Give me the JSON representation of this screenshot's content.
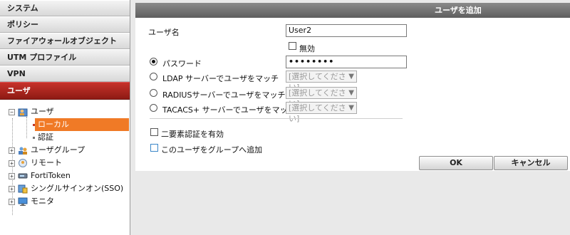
{
  "sidebar": {
    "nav": [
      {
        "label": "システム"
      },
      {
        "label": "ポリシー"
      },
      {
        "label": "ファイアウォールオブジェクト"
      },
      {
        "label": "UTM プロファイル"
      },
      {
        "label": "VPN"
      },
      {
        "label": "ユーザ"
      }
    ],
    "tree": {
      "user": "ユーザ",
      "local": "ローカル",
      "auth": "認証",
      "user_group": "ユーザグループ",
      "remote": "リモート",
      "fortitoken": "FortiToken",
      "sso": "シングルサインオン(SSO)",
      "monitor": "モニタ"
    }
  },
  "main": {
    "title": "ユーザを追加",
    "username_label": "ユーザ名",
    "username_value": "User2",
    "disable_label": "無効",
    "password_label": "パスワード",
    "password_value": "••••••••",
    "ldap_label": "LDAP サーバーでユーザをマッチ",
    "radius_label": "RADIUSサーバーでユーザをマッチ",
    "tacacs_label": "TACACS+ サーバーでユーザをマッチ",
    "select_placeholder": "[選択してください]",
    "two_factor_label": "二要素認証を有効",
    "add_to_group_label": "このユーザをグループへ追加",
    "ok_label": "OK",
    "cancel_label": "キャンセル"
  }
}
